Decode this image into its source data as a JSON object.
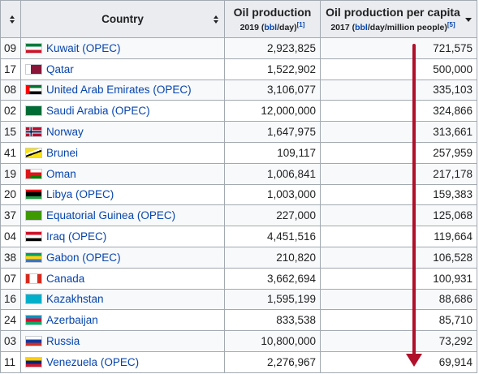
{
  "header": {
    "country": "Country",
    "oil_title": "Oil production",
    "oil_year": "2019 (",
    "oil_unit_link": "bbl",
    "oil_unit_rest": "/day)",
    "oil_ref": "[1]",
    "capita_title": "Oil production per capita",
    "capita_year": "2017 (",
    "capita_unit_link": "bbl",
    "capita_unit_rest": "/day/million people)",
    "capita_ref": "[5]"
  },
  "rows": [
    {
      "rank": "09",
      "country": "Kuwait",
      "opec": " (OPEC)",
      "oil": "2,923,825",
      "capita": "721,575",
      "flag": "kuwait"
    },
    {
      "rank": "17",
      "country": "Qatar",
      "opec": "",
      "oil": "1,522,902",
      "capita": "500,000",
      "flag": "qatar"
    },
    {
      "rank": "08",
      "country": "United Arab Emirates",
      "opec": " (OPEC)",
      "oil": "3,106,077",
      "capita": "335,103",
      "flag": "uae"
    },
    {
      "rank": "02",
      "country": "Saudi Arabia",
      "opec": " (OPEC)",
      "oil": "12,000,000",
      "capita": "324,866",
      "flag": "saudi"
    },
    {
      "rank": "15",
      "country": "Norway",
      "opec": "",
      "oil": "1,647,975",
      "capita": "313,661",
      "flag": "norway"
    },
    {
      "rank": "41",
      "country": "Brunei",
      "opec": "",
      "oil": "109,117",
      "capita": "257,959",
      "flag": "brunei"
    },
    {
      "rank": "19",
      "country": "Oman",
      "opec": "",
      "oil": "1,006,841",
      "capita": "217,178",
      "flag": "oman"
    },
    {
      "rank": "20",
      "country": "Libya",
      "opec": " (OPEC)",
      "oil": "1,003,000",
      "capita": "159,383",
      "flag": "libya"
    },
    {
      "rank": "37",
      "country": "Equatorial Guinea",
      "opec": " (OPEC)",
      "oil": "227,000",
      "capita": "125,068",
      "flag": "eqguinea"
    },
    {
      "rank": "04",
      "country": "Iraq",
      "opec": " (OPEC)",
      "oil": "4,451,516",
      "capita": "119,664",
      "flag": "iraq"
    },
    {
      "rank": "38",
      "country": "Gabon",
      "opec": " (OPEC)",
      "oil": "210,820",
      "capita": "106,528",
      "flag": "gabon"
    },
    {
      "rank": "07",
      "country": "Canada",
      "opec": "",
      "oil": "3,662,694",
      "capita": "100,931",
      "flag": "canada"
    },
    {
      "rank": "16",
      "country": "Kazakhstan",
      "opec": "",
      "oil": "1,595,199",
      "capita": "88,686",
      "flag": "kazakhstan"
    },
    {
      "rank": "24",
      "country": "Azerbaijan",
      "opec": "",
      "oil": "833,538",
      "capita": "85,710",
      "flag": "azerbaijan"
    },
    {
      "rank": "03",
      "country": "Russia",
      "opec": "",
      "oil": "10,800,000",
      "capita": "73,292",
      "flag": "russia"
    },
    {
      "rank": "11",
      "country": "Venezuela",
      "opec": " (OPEC)",
      "oil": "2,276,967",
      "capita": "69,914",
      "flag": "venezuela"
    }
  ],
  "colors": {
    "link": "#0645ad",
    "header_bg": "#eaecf0",
    "border": "#a2a9b1",
    "arrow": "#b0102a"
  }
}
